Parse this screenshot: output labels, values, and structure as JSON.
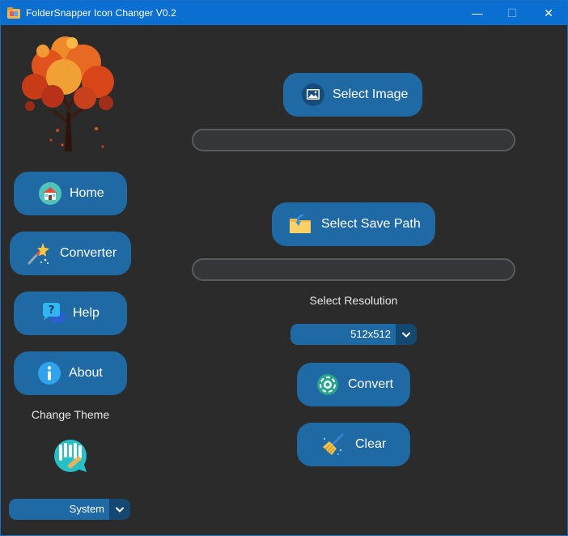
{
  "window": {
    "title": "FolderSnapper Icon Changer V0.2",
    "controls": {
      "minimize": "—",
      "maximize": "☐",
      "close": "✕"
    }
  },
  "sidebar": {
    "logo_icon": "autumn-tree-icon",
    "items": [
      {
        "label": "Home",
        "icon": "house-icon"
      },
      {
        "label": "Converter",
        "icon": "magic-wand-icon"
      },
      {
        "label": "Help",
        "icon": "help-chat-icon"
      },
      {
        "label": "About",
        "icon": "info-icon"
      }
    ],
    "theme": {
      "label": "Change Theme",
      "icon": "paint-brush-icon",
      "selected": "System"
    }
  },
  "main": {
    "select_image": {
      "label": "Select Image",
      "icon": "image-icon",
      "path_value": ""
    },
    "select_save_path": {
      "label": "Select Save Path",
      "icon": "folder-icon",
      "path_value": ""
    },
    "resolution": {
      "label": "Select Resolution",
      "selected": "512x512"
    },
    "convert": {
      "label": "Convert",
      "icon": "convert-icon"
    },
    "clear": {
      "label": "Clear",
      "icon": "broom-icon"
    }
  },
  "colors": {
    "accent": "#1f6aa5",
    "titlebar": "#0a6fd0",
    "background": "#2b2b2b",
    "entry_border": "#565b5e",
    "tree_foliage": "#e0531c"
  }
}
